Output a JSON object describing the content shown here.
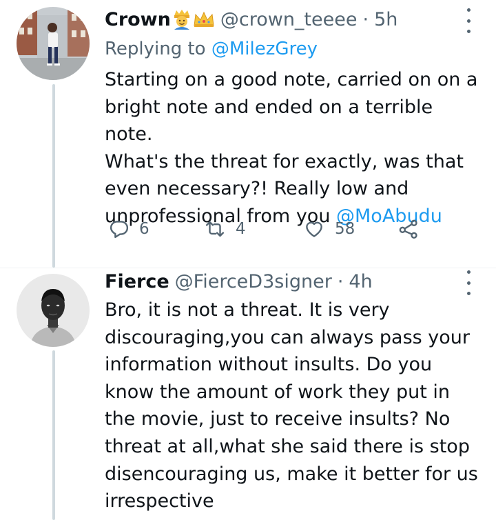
{
  "tweets": [
    {
      "display_name": "Crown",
      "name_emojis": [
        "prince-emoji",
        "crown-emoji"
      ],
      "handle": "@crown_teeee",
      "separator": "·",
      "time": "5h",
      "replying_prefix": "Replying to ",
      "replying_to": "@MilezGrey",
      "body_lines": [
        "Starting on a good note, carried on on a",
        "bright note and ended on a terrible note.",
        "What's the threat for exactly, was that",
        "even necessary?! Really low and"
      ],
      "body_last_prefix": "unprofessional from you ",
      "body_mention": "@MoAbudu",
      "actions": {
        "reply_count": "6",
        "retweet_count": "4",
        "like_count": "58",
        "reply_icon": "reply-icon",
        "retweet_icon": "retweet-icon",
        "like_icon": "heart-icon",
        "share_icon": "share-icon"
      }
    },
    {
      "display_name": "Fierce",
      "handle": "@FierceD3signer",
      "separator": "·",
      "time": "4h",
      "body_lines": [
        "Bro, it is not a threat. It is very",
        "discouraging,you can always pass your",
        "information without insults. Do you",
        "know the amount of work they put in",
        "the movie, just to receive insults? No",
        "threat at all,what she said there is stop",
        "disencouraging us, make it better for us",
        "irrespective"
      ]
    }
  ],
  "colors": {
    "text": "#0f1419",
    "secondary": "#536471",
    "link": "#1d9bf0",
    "thread_line": "#cfd9de",
    "divider": "#eff3f4"
  }
}
